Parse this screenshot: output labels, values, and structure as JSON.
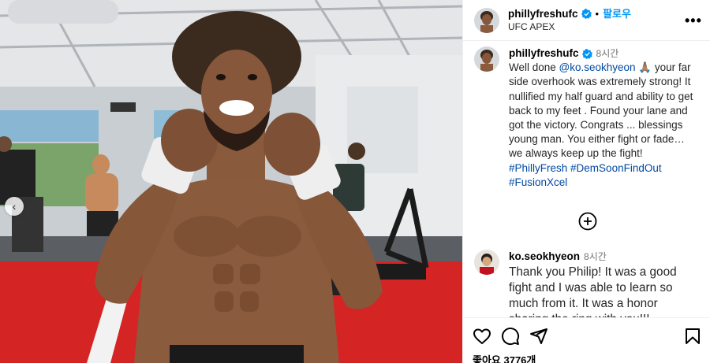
{
  "post": {
    "username": "phillyfreshufc",
    "follow_label": "팔로우",
    "dot": "•",
    "location": "UFC APEX",
    "more_label": "•••"
  },
  "caption": {
    "username": "phillyfreshufc",
    "time": "8시간",
    "text_before_mention": "Well done ",
    "mention": "@ko.seokhyeon",
    "emoji": " 🙏🏽 ",
    "text_after_mention": "your far side overhook was extremely strong! It nullified my half guard and ability to get back to my feet . Found your lane and got the victory. Congrats ... blessings young man. You either fight or fade… we always keep up the fight!",
    "hashtags": [
      "#PhillyFresh",
      "#DemSoonFindOut",
      "#FusionXcel"
    ]
  },
  "reply": {
    "username": "ko.seokhyeon",
    "time": "8시간",
    "text": "Thank you Philip! It was a good fight and I was able to learn so much from it. It was a honor sharing the ring with you!!!"
  },
  "actions": {
    "likes_label": "좋아요 3776개"
  },
  "icons": {
    "verified": "verified-badge-icon",
    "more": "more-options-icon",
    "load_more": "plus-circle-icon",
    "like": "heart-icon",
    "comment": "comment-icon",
    "share": "share-icon",
    "save": "bookmark-icon",
    "carousel": "chevron-left-icon"
  },
  "colors": {
    "accent": "#0095f6",
    "link": "#0049a3",
    "muted": "#737373",
    "verified": "#0095f6"
  }
}
